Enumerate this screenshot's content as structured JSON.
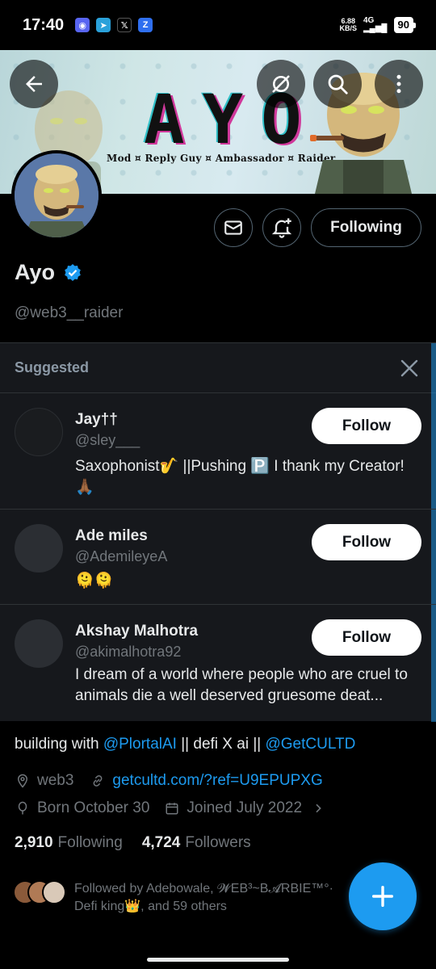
{
  "status_bar": {
    "time": "17:40",
    "net_speed_top": "6.88",
    "net_speed_bottom": "KB/S",
    "network": "4G",
    "battery": "90"
  },
  "banner": {
    "title": "AYO",
    "subtitle": "Mod ¤ Reply Guy ¤ Ambassador ¤ Raider"
  },
  "profile": {
    "name": "Ayo",
    "handle": "@web3__raider",
    "following_button": "Following",
    "bio_prefix": "building with ",
    "bio_link1": "@PlortalAI",
    "bio_middle": " || defi X ai || ",
    "bio_link2": "@GetCULTD",
    "location": "web3",
    "website": "getcultd.com/?ref=U9EPUPXG",
    "born": "Born October 30",
    "joined": "Joined July 2022",
    "following_count": "2,910",
    "following_label": "Following",
    "followers_count": "4,724",
    "followers_label": "Followers",
    "followed_by": "Followed by Adebowale, 𝓦EB³~B𝓐RBIE™°·",
    "followed_by_2": "Defi king👑, and 59 others"
  },
  "suggested": {
    "title": "Suggested",
    "items": [
      {
        "name": "Jay††",
        "handle": "@sley___",
        "bio": "Saxophonist🎷 ||Pushing 🅿️ I thank my Creator! 🙏🏾",
        "button": "Follow"
      },
      {
        "name": "Ade miles",
        "handle": "@AdemileyeA",
        "bio": "🫠🫠",
        "button": "Follow"
      },
      {
        "name": "Akshay Malhotra",
        "handle": "@akimalhotra92",
        "bio": "I dream of a world where people who are cruel to animals die a well deserved gruesome deat...",
        "button": "Follow"
      }
    ]
  },
  "colors": {
    "accent": "#1d9bf0",
    "background": "#000000",
    "card": "#16181c",
    "muted": "#71767b"
  }
}
